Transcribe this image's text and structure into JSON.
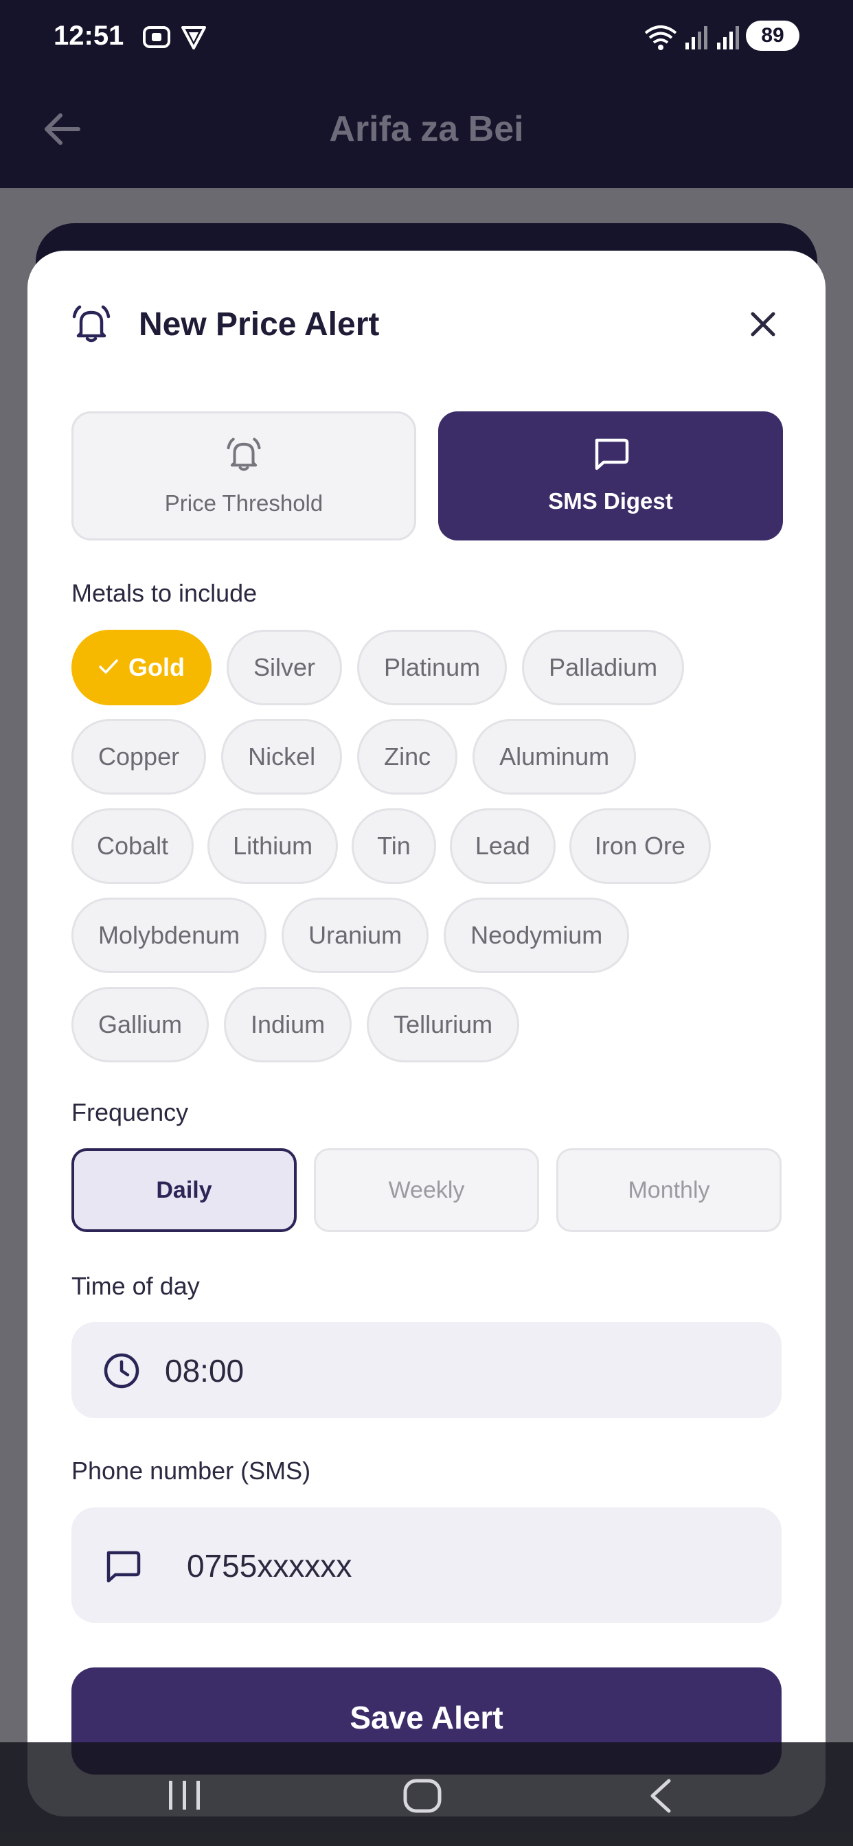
{
  "status_bar": {
    "time": "12:51",
    "battery": "89",
    "icons": [
      "screenshot-icon",
      "vpn-icon",
      "wifi-icon",
      "signal-icon",
      "signal-icon"
    ]
  },
  "app_bar": {
    "title": "Arifa za Bei",
    "back_icon": "back-arrow-icon"
  },
  "sheet": {
    "title": "New Price Alert",
    "header_icon": "bell-icon",
    "close_icon": "close-icon"
  },
  "modes": [
    {
      "label": "Price Threshold",
      "icon": "bell-icon",
      "selected": false
    },
    {
      "label": "SMS Digest",
      "icon": "message-icon",
      "selected": true
    }
  ],
  "metals": {
    "label": "Metals to include",
    "rows": [
      [
        {
          "name": "Gold",
          "selected": true
        },
        {
          "name": "Silver",
          "selected": false
        },
        {
          "name": "Platinum",
          "selected": false
        },
        {
          "name": "Palladium",
          "selected": false
        }
      ],
      [
        {
          "name": "Copper",
          "selected": false
        },
        {
          "name": "Nickel",
          "selected": false
        },
        {
          "name": "Zinc",
          "selected": false
        },
        {
          "name": "Aluminum",
          "selected": false
        }
      ],
      [
        {
          "name": "Cobalt",
          "selected": false
        },
        {
          "name": "Lithium",
          "selected": false
        },
        {
          "name": "Tin",
          "selected": false
        },
        {
          "name": "Lead",
          "selected": false
        },
        {
          "name": "Iron Ore",
          "selected": false
        }
      ],
      [
        {
          "name": "Molybdenum",
          "selected": false
        },
        {
          "name": "Uranium",
          "selected": false
        },
        {
          "name": "Neodymium",
          "selected": false
        }
      ],
      [
        {
          "name": "Gallium",
          "selected": false
        },
        {
          "name": "Indium",
          "selected": false
        },
        {
          "name": "Tellurium",
          "selected": false
        }
      ]
    ]
  },
  "frequency": {
    "label": "Frequency",
    "options": [
      "Daily",
      "Weekly",
      "Monthly"
    ],
    "selected": "Daily"
  },
  "time_of_day": {
    "label": "Time of day",
    "value": "08:00",
    "icon": "clock-icon"
  },
  "phone": {
    "label": "Phone number (SMS)",
    "value": "0755xxxxxx",
    "icon": "message-icon"
  },
  "save_label": "Save Alert",
  "colors": {
    "primary": "#3c2d69",
    "accent": "#f7b800",
    "sheet_bg": "#ffffff",
    "topbar_bg": "#15142a"
  },
  "nav_bar": [
    "recents-icon",
    "home-icon",
    "back-icon"
  ]
}
